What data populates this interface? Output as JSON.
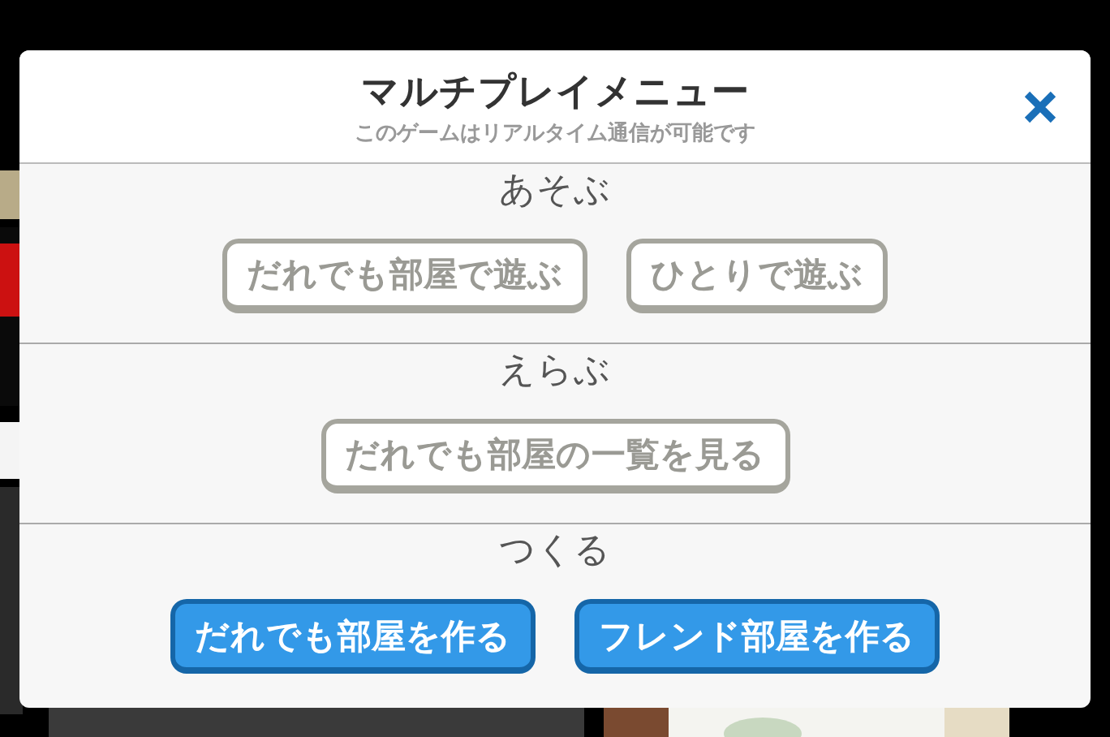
{
  "dialog": {
    "title": "マルチプレイメニュー",
    "subtitle": "このゲームはリアルタイム通信が可能です"
  },
  "sections": [
    {
      "heading": "あそぶ",
      "buttons": [
        {
          "label": "だれでも部屋で遊ぶ",
          "kind": "secondary"
        },
        {
          "label": "ひとりで遊ぶ",
          "kind": "secondary"
        }
      ]
    },
    {
      "heading": "えらぶ",
      "buttons": [
        {
          "label": "だれでも部屋の一覧を見る",
          "kind": "secondary"
        }
      ]
    },
    {
      "heading": "つくる",
      "buttons": [
        {
          "label": "だれでも部屋を作る",
          "kind": "primary"
        },
        {
          "label": "フレンド部屋を作る",
          "kind": "primary"
        }
      ]
    }
  ]
}
